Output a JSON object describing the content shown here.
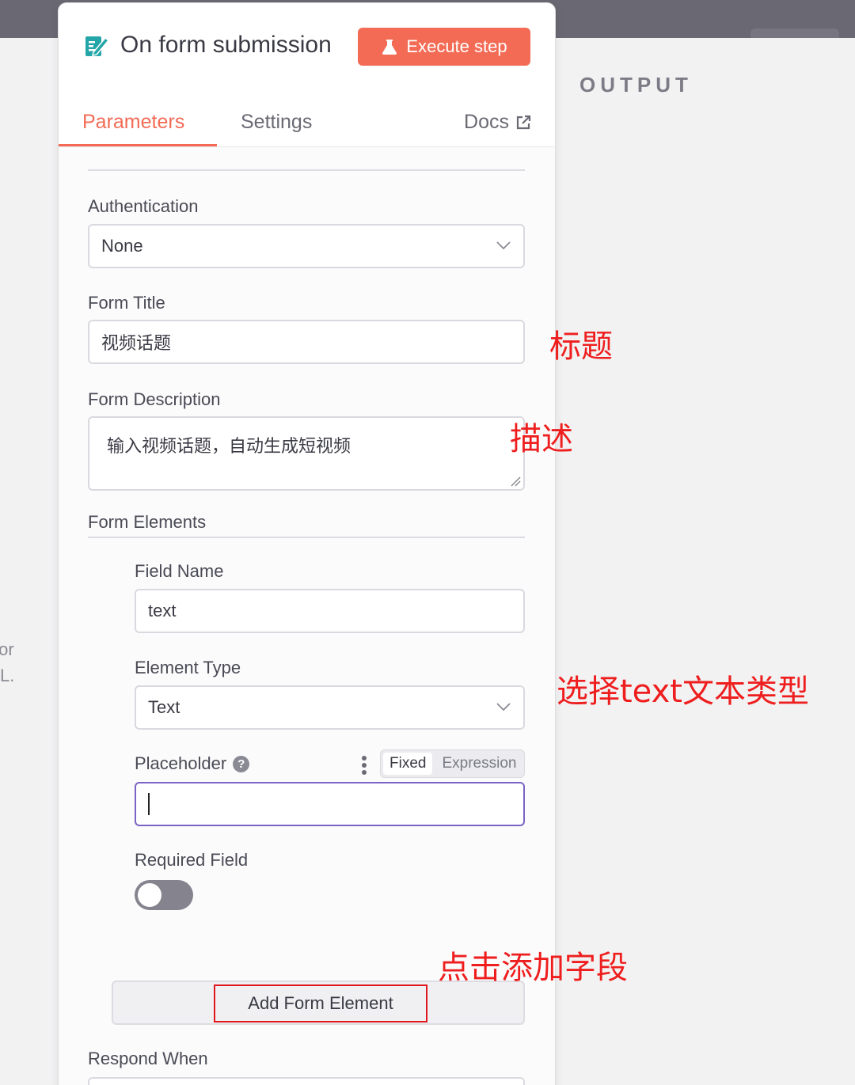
{
  "output_label": "OUTPUT",
  "left_hint": [
    "for",
    "L."
  ],
  "node": {
    "icon": "form-icon",
    "title": "On form submission",
    "execute_label": "Execute step",
    "execute_icon": "flask-icon"
  },
  "tabs": {
    "parameters": "Parameters",
    "settings": "Settings",
    "docs": "Docs",
    "docs_icon": "external-link-icon",
    "active": "Parameters"
  },
  "fields": {
    "authentication": {
      "label": "Authentication",
      "value": "None"
    },
    "form_title": {
      "label": "Form Title",
      "value": "视频话题"
    },
    "form_description": {
      "label": "Form Description",
      "value": "输入视频话题，自动生成短视频"
    },
    "form_elements": {
      "label": "Form Elements",
      "field_name": {
        "label": "Field Name",
        "value": "text"
      },
      "element_type": {
        "label": "Element Type",
        "value": "Text"
      },
      "placeholder": {
        "label": "Placeholder",
        "help_icon": "question-icon",
        "value": "",
        "mode_fixed": "Fixed",
        "mode_expression": "Expression",
        "active_mode": "Fixed"
      },
      "required_field": {
        "label": "Required Field",
        "enabled": false
      },
      "add_button": "Add Form Element"
    },
    "respond_when": {
      "label": "Respond When"
    }
  },
  "annotations": {
    "title": "标题",
    "description": "描述",
    "element_type": "选择text文本类型",
    "add_field": "点击添加字段"
  },
  "colors": {
    "accent": "#f36b55",
    "annotation": "#ef1e1e",
    "focus_border": "#7b63c6",
    "node_icon": "#24a6a8"
  }
}
